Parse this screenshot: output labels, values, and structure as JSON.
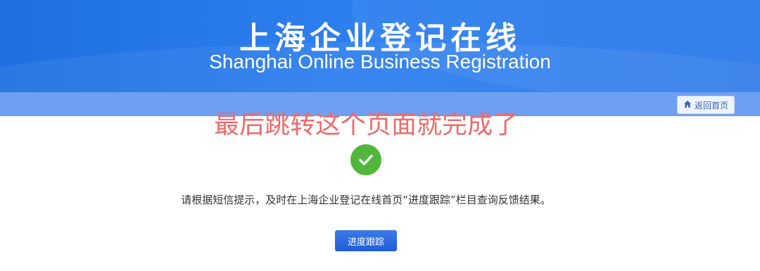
{
  "header": {
    "title_cn": "上海企业登记在线",
    "title_en": "Shanghai Online Business Registration"
  },
  "nav": {
    "home_label": "返回首页",
    "home_icon": "home-icon"
  },
  "annotation": {
    "text": "最后跳转这个页面就完成了",
    "color": "#f06a6a"
  },
  "result": {
    "status_icon": "check-circle-icon",
    "status_color": "#52b63c",
    "message": "请根据短信提示，及时在上海企业登记在线首页“进度跟踪”栏目查询反馈结果。",
    "track_button_label": "进度跟踪"
  },
  "colors": {
    "banner": "#2b7ae8",
    "nav_strip": "#6f9ff0",
    "button": "#2a6ae0"
  }
}
